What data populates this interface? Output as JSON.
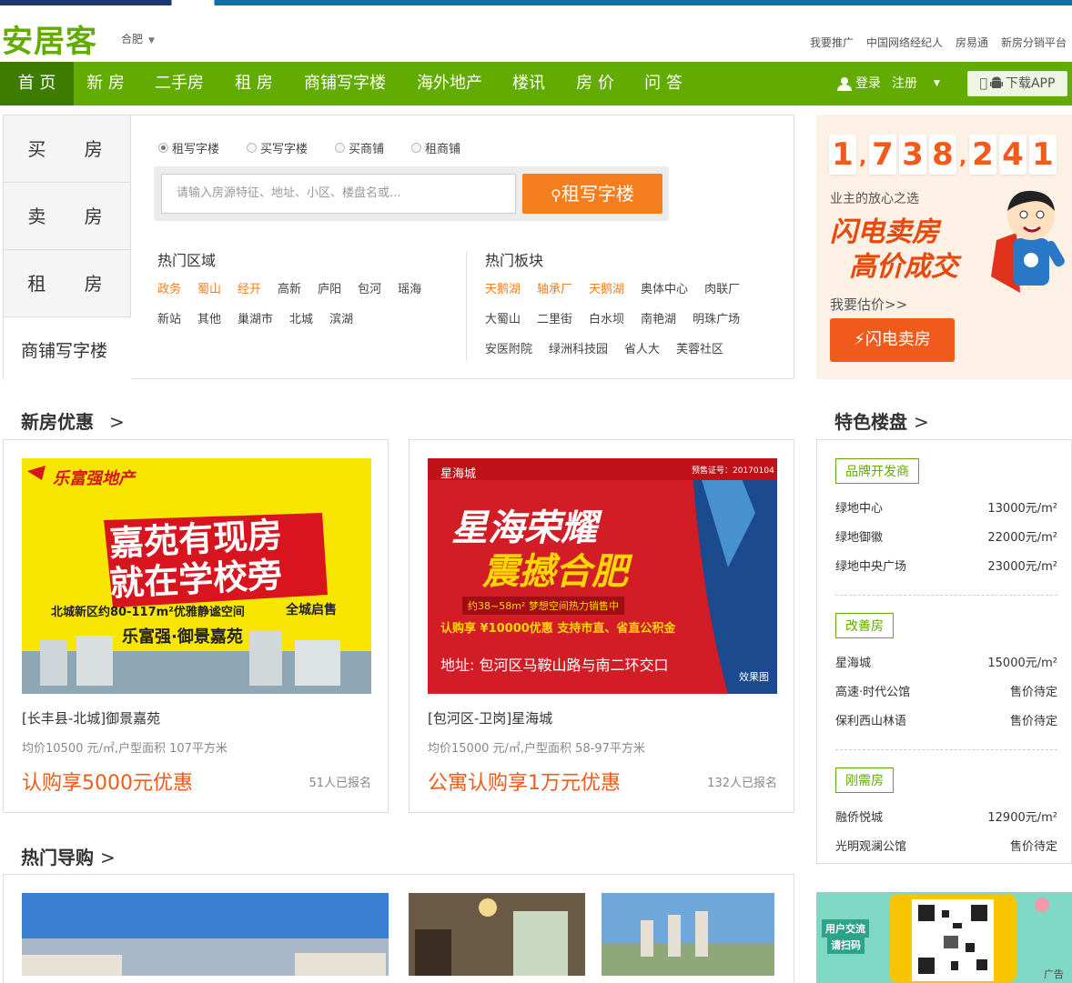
{
  "header": {
    "logo": "安居客",
    "city": "合肥",
    "links": [
      "我要推广",
      "中国网络经纪人",
      "房易通",
      "新房分销平台"
    ]
  },
  "nav": {
    "items": [
      "首 页",
      "新 房",
      "二手房",
      "租 房",
      "商铺写字楼",
      "海外地产",
      "楼讯",
      "房 价",
      "问 答"
    ],
    "login": "登录",
    "register": "注册",
    "app": "下载APP"
  },
  "search": {
    "tabs": [
      "买 房",
      "卖 房",
      "租 房",
      "商铺写字楼"
    ],
    "radios": [
      "租写字楼",
      "买写字楼",
      "买商铺",
      "租商铺"
    ],
    "placeholder": "请输入房源特征、地址、小区、楼盘名或...",
    "button": "租写字楼",
    "hot_area_title": "热门区域",
    "hot_areas": [
      "政务",
      "蜀山",
      "经开",
      "高新",
      "庐阳",
      "包河",
      "瑶海",
      "新站",
      "其他",
      "巢湖市",
      "北城",
      "滨湖"
    ],
    "hot_block_title": "热门板块",
    "hot_blocks": [
      "天鹅湖",
      "轴承厂",
      "天鹅湖",
      "奥体中心",
      "肉联厂",
      "大蜀山",
      "二里街",
      "白水坝",
      "南艳湖",
      "明珠广场",
      "安医附院",
      "绿洲科技园",
      "省人大",
      "芙蓉社区"
    ]
  },
  "promo": {
    "digits": [
      "1",
      ",",
      "7",
      "3",
      "8",
      ",",
      "2",
      "4",
      "1"
    ],
    "sub": "业主的放心之选",
    "big1": "闪电卖房",
    "big2": "高价成交",
    "estimate": "我要估价>>",
    "button": "闪电卖房"
  },
  "newhouse": {
    "title": "新房优惠",
    "chev": ">",
    "items": [
      {
        "name": "[长丰县-北城]御景嘉苑",
        "info": "均价10500 元/㎡,户型面积 107平方米",
        "deal": "认购享5000元优惠",
        "count": "51人已报名",
        "ad_brand": "乐富强地产",
        "ad_line1": "嘉苑有现房",
        "ad_line2": "就在学校旁",
        "ad_text": "北城新区约80-117m²优雅静谧空间",
        "ad_tag": "全城启售",
        "ad_sign": "乐富强·御景嘉苑"
      },
      {
        "name": "[包河区-卫岗]星海城",
        "info": "均价15000 元/㎡,户型面积 58-97平方米",
        "deal": "公寓认购享1万元优惠",
        "count": "132人已报名",
        "ad_brand": "星海城",
        "ad_cert": "预售证号：20170104",
        "ad_line1": "星海荣耀",
        "ad_line2": "震撼合肥",
        "ad_text": "约38~58m² 梦想空间热力销售中",
        "ad_price": "认购享 ¥10000优惠  支持市直、省直公积金",
        "ad_addr": "地址: 包河区马鞍山路与南二环交口",
        "ad_note": "效果图"
      }
    ]
  },
  "feature": {
    "title": "特色楼盘",
    "chev": ">",
    "groups": [
      {
        "label": "品牌开发商",
        "rows": [
          {
            "n": "绿地中心",
            "p": "13000元/m²"
          },
          {
            "n": "绿地御徽",
            "p": "22000元/m²"
          },
          {
            "n": "绿地中央广场",
            "p": "23000元/m²"
          }
        ]
      },
      {
        "label": "改善房",
        "rows": [
          {
            "n": "星海城",
            "p": "15000元/m²"
          },
          {
            "n": "高速·时代公馆",
            "p": "售价待定"
          },
          {
            "n": "保利西山林语",
            "p": "售价待定"
          }
        ]
      },
      {
        "label": "刚需房",
        "rows": [
          {
            "n": "融侨悦城",
            "p": "12900元/m²"
          },
          {
            "n": "光明观澜公馆",
            "p": "售价待定"
          }
        ]
      }
    ]
  },
  "guide": {
    "title": "热门导购",
    "chev": ">"
  },
  "qr": {
    "text1": "用户交流",
    "text2": "请扫码",
    "ad": "广告"
  },
  "colors": {
    "brand": "#62ab00",
    "accent": "#f47e1e"
  }
}
